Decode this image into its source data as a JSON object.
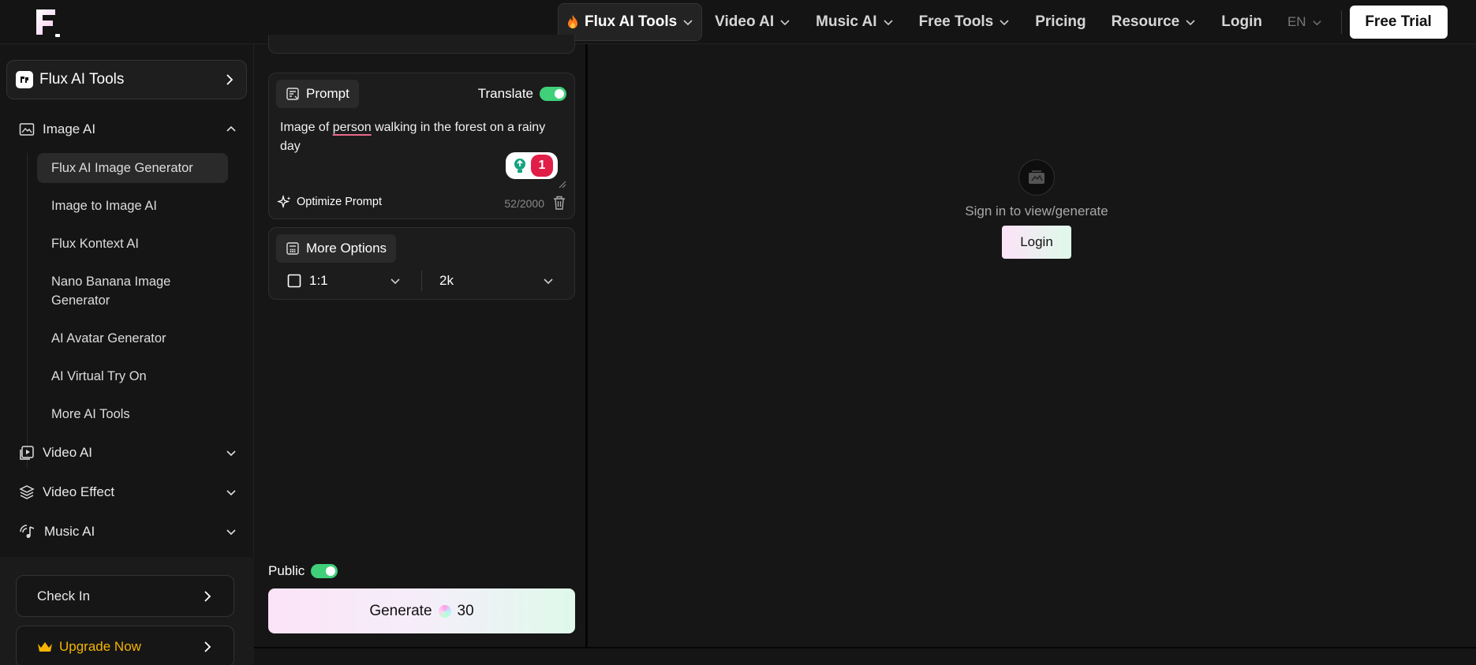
{
  "nav": {
    "items": [
      {
        "label": "Flux AI Tools",
        "active": true,
        "dropdown": true
      },
      {
        "label": "Video AI",
        "dropdown": true
      },
      {
        "label": "Music AI",
        "dropdown": true
      },
      {
        "label": "Free Tools",
        "dropdown": true
      },
      {
        "label": "Pricing",
        "dropdown": false
      },
      {
        "label": "Resource",
        "dropdown": true
      },
      {
        "label": "Login",
        "dropdown": false
      }
    ],
    "language": "EN",
    "free_trial": "Free Trial"
  },
  "sidebar": {
    "tools_label": "Flux AI Tools",
    "sections": [
      {
        "label": "Image AI",
        "expanded": true,
        "icon": "image-icon"
      },
      {
        "label": "Video AI",
        "expanded": false,
        "icon": "video-icon"
      },
      {
        "label": "Video Effect",
        "expanded": false,
        "icon": "layers-icon"
      },
      {
        "label": "Music AI",
        "expanded": false,
        "icon": "music-icon"
      }
    ],
    "image_ai_items": [
      {
        "label": "Flux AI Image Generator",
        "active": true
      },
      {
        "label": "Image to Image AI"
      },
      {
        "label": "Flux Kontext AI"
      },
      {
        "label": "Nano Banana Image Generator"
      },
      {
        "label": "AI Avatar Generator"
      },
      {
        "label": "AI Virtual Try On"
      },
      {
        "label": "More AI Tools"
      }
    ],
    "check_in": "Check In",
    "upgrade": "Upgrade Now"
  },
  "prompt": {
    "label": "Prompt",
    "translate_label": "Translate",
    "translate_on": true,
    "text_before": "Image of ",
    "text_flagged": "person",
    "text_after": " walking in the forest on a rainy day",
    "grammar_count": "1",
    "optimize_label": "Optimize Prompt",
    "char_count": "52/2000"
  },
  "options": {
    "label": "More Options",
    "aspect_ratio": "1:1",
    "resolution": "2k"
  },
  "footer": {
    "public_label": "Public",
    "public_on": true,
    "generate_label": "Generate",
    "generate_cost": "30"
  },
  "preview": {
    "message": "Sign in to view/generate",
    "login_label": "Login"
  },
  "colors": {
    "toggle_on": "#3fd079",
    "upgrade_text": "#f4b400",
    "grammar_badge": "#e01e48"
  }
}
